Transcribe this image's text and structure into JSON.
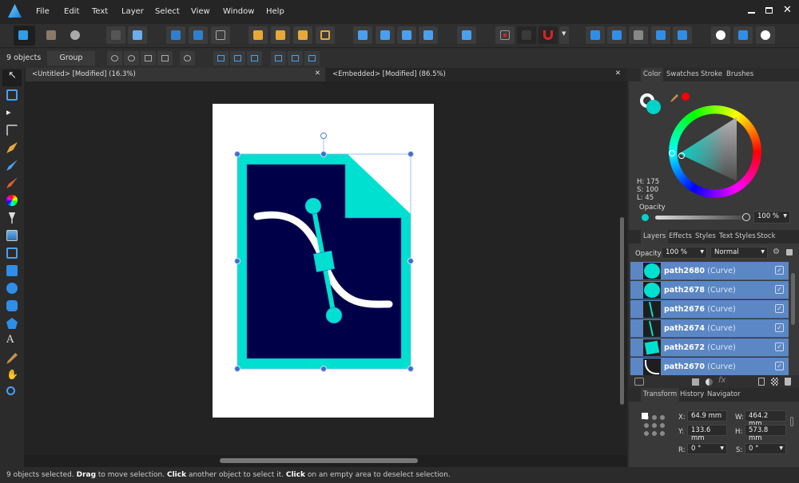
{
  "app": {
    "name": "Affinity Designer",
    "accent": "#2f9ee8"
  },
  "menu": [
    "File",
    "Edit",
    "Text",
    "Layer",
    "Select",
    "View",
    "Window",
    "Help"
  ],
  "context": {
    "selection_count": "9 objects",
    "group_label": "Group"
  },
  "tabs": [
    {
      "label": "<Untitled> [Modified] (16.3%)"
    },
    {
      "label": "<Embedded> [Modified] (86.5%)"
    }
  ],
  "color_panel": {
    "tabs": [
      "Color",
      "Swatches",
      "Stroke",
      "Brushes"
    ],
    "h": "H: 175",
    "s": "S: 100",
    "l": "L: 45",
    "opacity_label": "Opacity",
    "opacity": "100 %",
    "fill_color": "#00d4c8",
    "stroke_color": "#ff0000"
  },
  "layers_panel": {
    "tabs": [
      "Layers",
      "Effects",
      "Styles",
      "Text Styles",
      "Stock"
    ],
    "opacity_label": "Opacity:",
    "opacity": "100 %",
    "blend": "Normal",
    "layers": [
      {
        "name": "path2680",
        "type": "(Curve)"
      },
      {
        "name": "path2678",
        "type": "(Curve)"
      },
      {
        "name": "path2676",
        "type": "(Curve)"
      },
      {
        "name": "path2674",
        "type": "(Curve)"
      },
      {
        "name": "path2672",
        "type": "(Curve)"
      },
      {
        "name": "path2670",
        "type": "(Curve)"
      }
    ]
  },
  "transform_panel": {
    "tabs": [
      "Transform",
      "History",
      "Navigator"
    ],
    "x_label": "X:",
    "x": "64.9 mm",
    "y_label": "Y:",
    "y": "133.6 mm",
    "w_label": "W:",
    "w": "464.2 mm",
    "h_label": "H:",
    "h": "573.8 mm",
    "r_label": "R:",
    "r": "0 °",
    "s_label": "S:",
    "s": "0 °"
  },
  "status": {
    "p1": "9 objects selected. ",
    "b1": "Drag",
    "p2": " to move selection. ",
    "b2": "Click",
    "p3": " another object to select it. ",
    "b3": "Click",
    "p4": " on an empty area to deselect selection."
  },
  "artwork": {
    "frame": "#00e0d0",
    "background": "#000048",
    "curve": "#ffffff"
  }
}
